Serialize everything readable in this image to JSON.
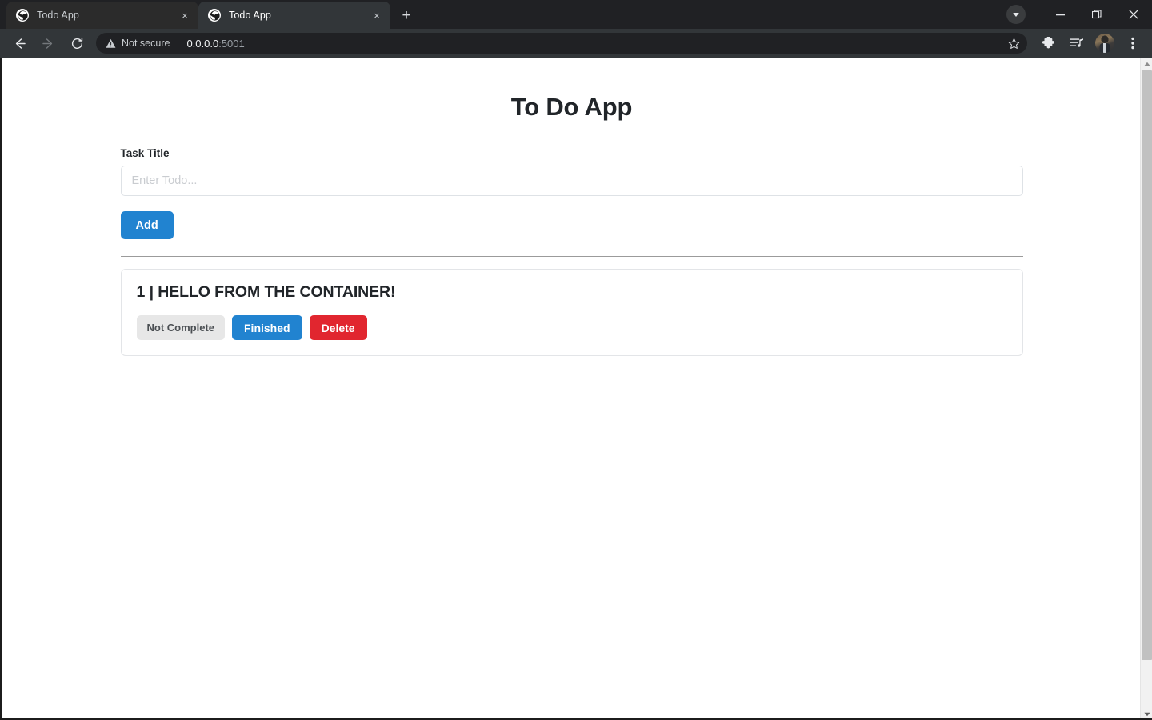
{
  "browser": {
    "tabs": [
      {
        "title": "Todo App",
        "favicon": "globe-icon",
        "active": false,
        "close_label": "×"
      },
      {
        "title": "Todo App",
        "favicon": "globe-icon",
        "active": true,
        "close_label": "×"
      }
    ],
    "new_tab_label": "+",
    "window_controls": {
      "download_label": "download-indicator",
      "minimize_label": "–",
      "restore_label": "restore-window",
      "close_label": "✕"
    },
    "navigation": {
      "back_label": "←",
      "forward_label": "→",
      "reload_label": "↻"
    },
    "omnibox": {
      "security_text": "Not secure",
      "url_host": "0.0.0.0",
      "url_port": ":5001",
      "bookmark_label": "bookmark-star"
    },
    "toolbar_icons": [
      "extensions-puzzle-icon",
      "media-playlist-icon",
      "profile-avatar",
      "chrome-menu-icon"
    ]
  },
  "page": {
    "title": "To Do App",
    "form": {
      "label": "Task Title",
      "input_value": "",
      "input_placeholder": "Enter Todo...",
      "add_button": "Add"
    },
    "todos": [
      {
        "title": "1 | HELLO FROM THE CONTAINER!",
        "status_button": "Not Complete",
        "finished_button": "Finished",
        "delete_button": "Delete"
      }
    ]
  },
  "colors": {
    "primary_blue": "#2183d0",
    "danger_red": "#e1262f",
    "neutral_gray": "#e7e7e7",
    "text_dark": "#212529",
    "chrome_dark": "#202124",
    "chrome_toolbar": "#323639"
  }
}
